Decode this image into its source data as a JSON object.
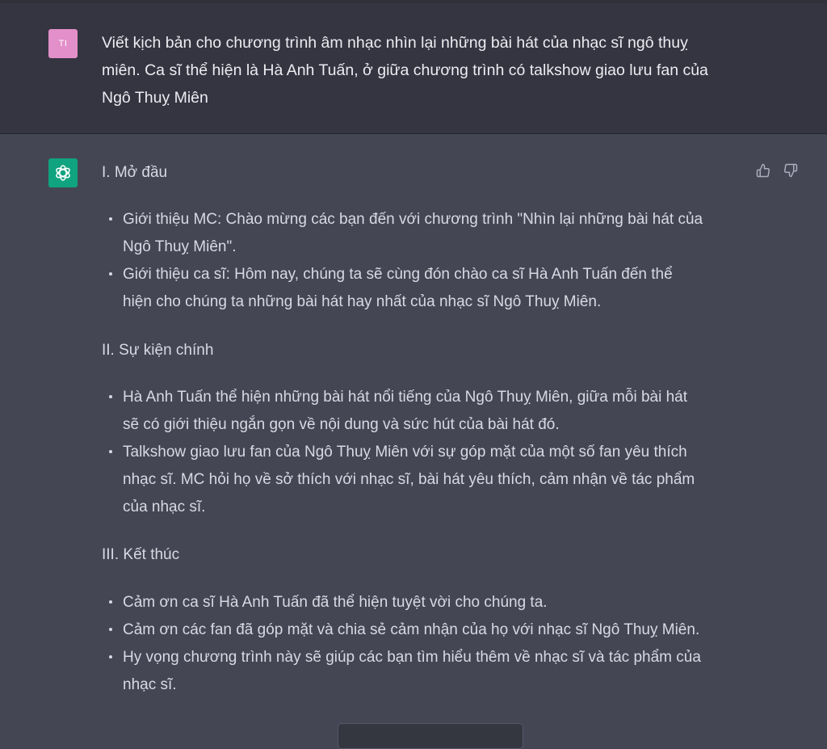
{
  "user_message": {
    "avatar_initials": "TI",
    "lines": [
      "Viết kịch bản cho chương trình âm nhạc nhìn lại những bài hát của nhạc sĩ ngô thuỵ",
      "miên. Ca sĩ thể hiện là Hà Anh Tuấn, ở giữa chương trình có talkshow giao lưu fan của",
      "Ngô Thuỵ Miên"
    ]
  },
  "assistant_message": {
    "avatar_icon": "openai-logo-icon",
    "feedback_icons": [
      "thumbs-up-icon",
      "thumbs-down-icon"
    ],
    "sections": [
      {
        "heading": "I. Mở đầu",
        "bullets": [
          [
            "Giới thiệu MC: Chào mừng các bạn đến với chương trình \"Nhìn lại những bài hát của",
            "Ngô Thuỵ Miên\"."
          ],
          [
            "Giới thiệu ca sĩ: Hôm nay, chúng ta sẽ cùng đón chào ca sĩ Hà Anh Tuấn đến thể",
            "hiện cho chúng ta những bài hát hay nhất của nhạc sĩ Ngô Thuỵ Miên."
          ]
        ]
      },
      {
        "heading": "II. Sự kiện chính",
        "bullets": [
          [
            "Hà Anh Tuấn thể hiện những bài hát nổi tiếng của Ngô Thuỵ Miên, giữa mỗi bài hát",
            "sẽ có giới thiệu ngắn gọn về nội dung và sức hút của bài hát đó."
          ],
          [
            "Talkshow giao lưu fan của Ngô Thuỵ Miên với sự góp mặt của một số fan yêu thích",
            "nhạc sĩ. MC hỏi họ về sở thích với nhạc sĩ, bài hát yêu thích, cảm nhận về tác phẩm",
            "của nhạc sĩ."
          ]
        ]
      },
      {
        "heading": "III. Kết thúc",
        "bullets": [
          [
            "Cảm ơn ca sĩ Hà Anh Tuấn đã thể hiện tuyệt vời cho chúng ta."
          ],
          [
            "Cảm ơn các fan đã góp mặt và chia sẻ cảm nhận của họ với nhạc sĩ Ngô Thuỵ Miên."
          ],
          [
            "Hy vọng chương trình này sẽ giúp các bạn tìm hiểu thêm về nhạc sĩ và tác phẩm của",
            "nhạc sĩ."
          ]
        ]
      }
    ]
  },
  "colors": {
    "user_background": "#343541",
    "assistant_background": "#444654",
    "user_avatar": "#e38fc9",
    "assistant_avatar": "#10a37f",
    "text": "#d9d9e3"
  }
}
